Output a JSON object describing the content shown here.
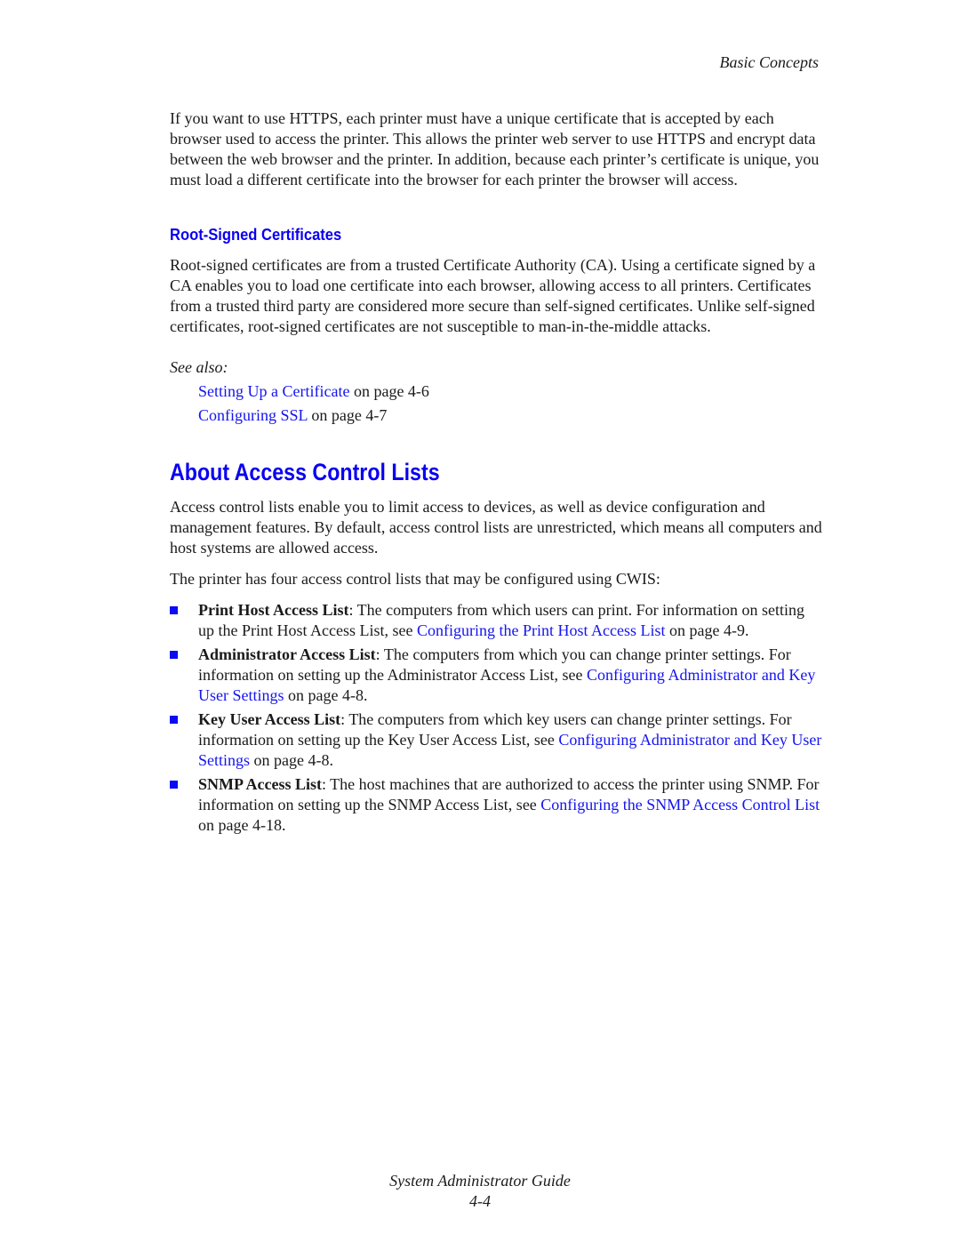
{
  "header": {
    "running_title": "Basic Concepts"
  },
  "intro": {
    "paragraph": "If you want to use HTTPS, each printer must have a unique certificate that is accepted by each browser used to access the printer. This allows the printer web server to use HTTPS and encrypt data between the web browser and the printer. In addition, because each printer’s certificate is unique, you must load a different certificate into the browser for each printer the browser will access."
  },
  "root_signed": {
    "heading": "Root-Signed Certificates",
    "paragraph": "Root-signed certificates are from a trusted Certificate Authority (CA). Using a certificate signed by a CA enables you to load one certificate into each browser, allowing access to all printers. Certificates from a trusted third party are considered more secure than self-signed certificates. Unlike self-signed certificates, root-signed certificates are not susceptible to man-in-the-middle attacks.",
    "see_also_label": "See also:",
    "references": [
      {
        "link": "Setting Up a Certificate",
        "suffix": " on page 4-6"
      },
      {
        "link": "Configuring SSL",
        "suffix": " on page 4-7"
      }
    ]
  },
  "acl_section": {
    "heading": "About Access Control Lists",
    "paragraph": "Access control lists enable you to limit access to devices, as well as device configuration and management features. By default, access control lists are unrestricted, which means all computers and host systems are allowed access.",
    "intro_line": "The printer has four access control lists that may be configured using CWIS:",
    "items": [
      {
        "term": "Print Host Access List",
        "text": ": The computers from which users can print. For information on setting up the Print Host Access List, see ",
        "link": "Configuring the Print Host Access List",
        "suffix": " on page 4-9."
      },
      {
        "term": "Administrator Access List",
        "text": ": The computers from which you can change printer settings. For information on setting up the Administrator Access List, see ",
        "link": "Configuring Administrator and Key User Settings",
        "suffix": " on page 4-8."
      },
      {
        "term": "Key User Access List",
        "text": ": The computers from which key users can change printer settings. For information on setting up the Key User Access List, see ",
        "link": "Configuring Administrator and Key User Settings",
        "suffix": " on page 4-8."
      },
      {
        "term": "SNMP Access List",
        "text": ": The host machines that are authorized to access the printer using SNMP. For information on setting up the SNMP Access List, see ",
        "link": "Configuring the SNMP Access Control List",
        "suffix": " on page 4-18."
      }
    ]
  },
  "footer": {
    "guide_title": "System Administrator Guide",
    "page_number": "4-4"
  },
  "colors": {
    "heading": "#0a00f0",
    "link": "#1414f0",
    "bullet": "#0a0af5",
    "text": "#1a1a1a"
  }
}
